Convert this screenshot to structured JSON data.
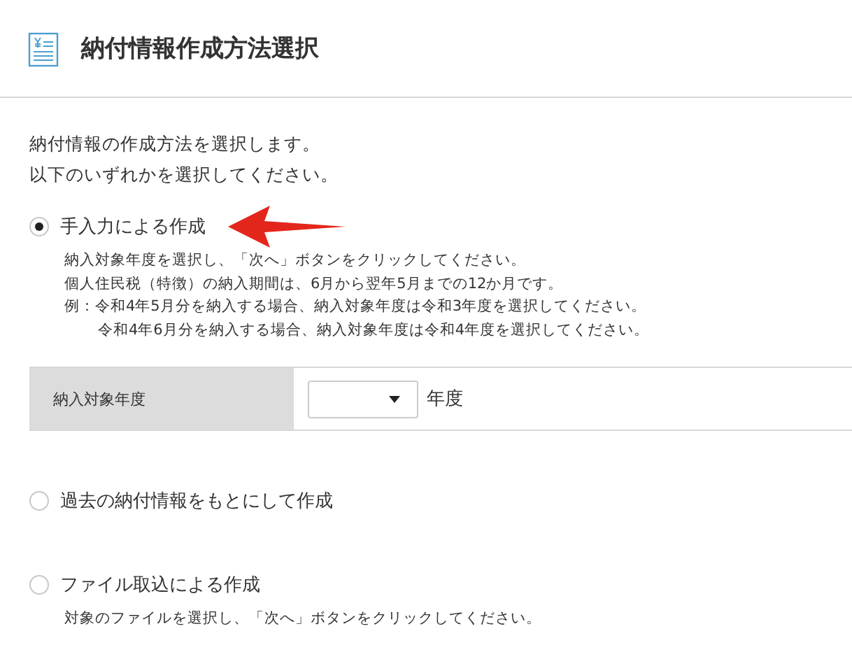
{
  "header": {
    "title": "納付情報作成方法選択"
  },
  "intro": [
    "納付情報の作成方法を選択します。",
    "以下のいずれかを選択してください。"
  ],
  "options": [
    {
      "label": "手入力による作成",
      "selected": true,
      "notes": [
        {
          "kind": "plain",
          "text": "納入対象年度を選択し、「次へ」ボタンをクリックしてください。"
        },
        {
          "kind": "plain",
          "text": "個人住民税（特徴）の納入期間は、6月から翌年5月までの12か月です。"
        },
        {
          "kind": "plain",
          "text": "例：令和4年5月分を納入する場合、納入対象年度は令和3年度を選択してください。"
        },
        {
          "kind": "continuation",
          "text": "令和4年6月分を納入する場合、納入対象年度は令和4年度を選択してください。"
        }
      ],
      "year_field": {
        "label": "納入対象年度",
        "unit": "年度"
      }
    },
    {
      "label": "過去の納付情報をもとにして作成",
      "selected": false
    },
    {
      "label": "ファイル取込による作成",
      "selected": false,
      "notes": [
        {
          "kind": "plain",
          "text": "対象のファイルを選択し、「次へ」ボタンをクリックしてください。"
        }
      ]
    }
  ]
}
